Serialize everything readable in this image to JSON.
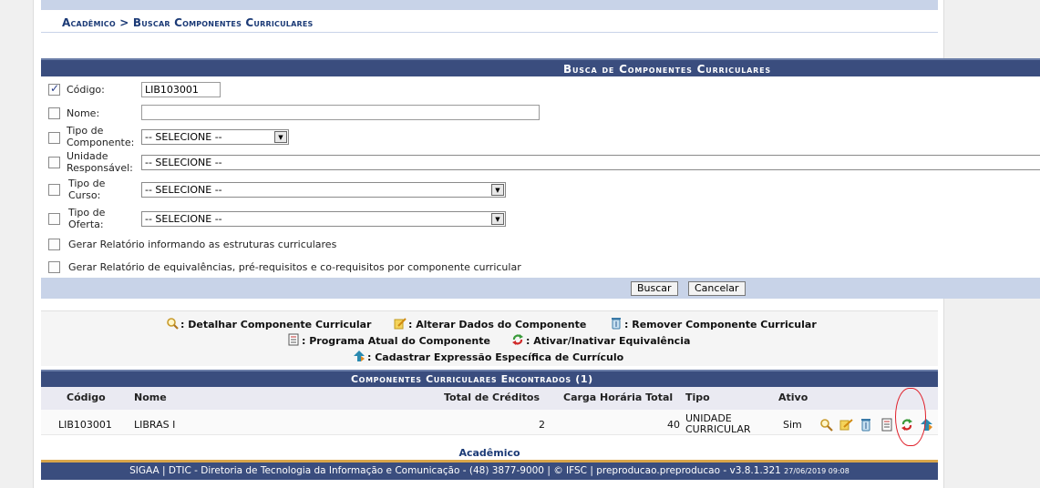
{
  "breadcrumb": "Acadêmico > Buscar Componentes Curriculares",
  "search": {
    "title": "Busca de Componentes Curriculares",
    "fields": {
      "codigo": {
        "label": "Código:",
        "value": "LIB103001",
        "checked": true
      },
      "nome": {
        "label": "Nome:",
        "value": ""
      },
      "tipo_componente": {
        "label1": "Tipo de",
        "label2": "Componente:",
        "value": "-- SELECIONE --"
      },
      "unidade": {
        "label1": "Unidade",
        "label2": "Responsável:",
        "value": "-- SELECIONE --"
      },
      "tipo_curso": {
        "label1": "Tipo de",
        "label2": "Curso:",
        "value": "-- SELECIONE --"
      },
      "tipo_oferta": {
        "label1": "Tipo de",
        "label2": "Oferta:",
        "value": "-- SELECIONE --"
      }
    },
    "report1": "Gerar Relatório informando as estruturas curriculares",
    "report2": "Gerar Relatório de equivalências, pré-requisitos e co-requisitos por componente curricular",
    "buttons": {
      "search": "Buscar",
      "cancel": "Cancelar"
    }
  },
  "legend": {
    "detail": ": Detalhar Componente Curricular",
    "edit": ": Alterar Dados do Componente",
    "remove": ": Remover Componente Curricular",
    "program": ": Programa Atual do Componente",
    "toggle": ": Ativar/Inativar Equivalência",
    "register": ": Cadastrar Expressão Específica de Currículo"
  },
  "results": {
    "title": "Componentes Curriculares Encontrados (1)",
    "columns": {
      "codigo": "Código",
      "nome": "Nome",
      "creditos": "Total de Créditos",
      "carga": "Carga Horária Total",
      "tipo": "Tipo",
      "ativo": "Ativo"
    },
    "rows": [
      {
        "codigo": "LIB103001",
        "nome": "LIBRAS I",
        "creditos": "2",
        "carga": "40",
        "tipo1": "UNIDADE",
        "tipo2": "CURRICULAR",
        "ativo": "Sim"
      }
    ]
  },
  "footer": {
    "link": "Acadêmico",
    "text": "SIGAA | DTIC - Diretoria de Tecnologia da Informação e Comunicação - (48) 3877-9000 | © IFSC | preproducao.preproducao - v3.8.1.321",
    "timestamp": "27/06/2019 09:08"
  },
  "colors": {
    "header": "#3a4d7e",
    "accent": "#c8d3e8",
    "footer_border": "#d9a64a",
    "annotation": "#e0202a"
  }
}
